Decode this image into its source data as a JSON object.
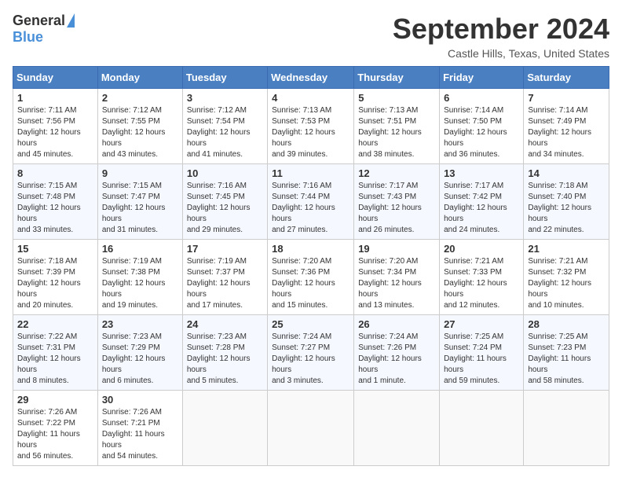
{
  "header": {
    "logo_general": "General",
    "logo_blue": "Blue",
    "title": "September 2024",
    "location": "Castle Hills, Texas, United States"
  },
  "days_of_week": [
    "Sunday",
    "Monday",
    "Tuesday",
    "Wednesday",
    "Thursday",
    "Friday",
    "Saturday"
  ],
  "weeks": [
    [
      {
        "day": "1",
        "sunrise": "7:11 AM",
        "sunset": "7:56 PM",
        "daylight": "12 hours and 45 minutes."
      },
      {
        "day": "2",
        "sunrise": "7:12 AM",
        "sunset": "7:55 PM",
        "daylight": "12 hours and 43 minutes."
      },
      {
        "day": "3",
        "sunrise": "7:12 AM",
        "sunset": "7:54 PM",
        "daylight": "12 hours and 41 minutes."
      },
      {
        "day": "4",
        "sunrise": "7:13 AM",
        "sunset": "7:53 PM",
        "daylight": "12 hours and 39 minutes."
      },
      {
        "day": "5",
        "sunrise": "7:13 AM",
        "sunset": "7:51 PM",
        "daylight": "12 hours and 38 minutes."
      },
      {
        "day": "6",
        "sunrise": "7:14 AM",
        "sunset": "7:50 PM",
        "daylight": "12 hours and 36 minutes."
      },
      {
        "day": "7",
        "sunrise": "7:14 AM",
        "sunset": "7:49 PM",
        "daylight": "12 hours and 34 minutes."
      }
    ],
    [
      {
        "day": "8",
        "sunrise": "7:15 AM",
        "sunset": "7:48 PM",
        "daylight": "12 hours and 33 minutes."
      },
      {
        "day": "9",
        "sunrise": "7:15 AM",
        "sunset": "7:47 PM",
        "daylight": "12 hours and 31 minutes."
      },
      {
        "day": "10",
        "sunrise": "7:16 AM",
        "sunset": "7:45 PM",
        "daylight": "12 hours and 29 minutes."
      },
      {
        "day": "11",
        "sunrise": "7:16 AM",
        "sunset": "7:44 PM",
        "daylight": "12 hours and 27 minutes."
      },
      {
        "day": "12",
        "sunrise": "7:17 AM",
        "sunset": "7:43 PM",
        "daylight": "12 hours and 26 minutes."
      },
      {
        "day": "13",
        "sunrise": "7:17 AM",
        "sunset": "7:42 PM",
        "daylight": "12 hours and 24 minutes."
      },
      {
        "day": "14",
        "sunrise": "7:18 AM",
        "sunset": "7:40 PM",
        "daylight": "12 hours and 22 minutes."
      }
    ],
    [
      {
        "day": "15",
        "sunrise": "7:18 AM",
        "sunset": "7:39 PM",
        "daylight": "12 hours and 20 minutes."
      },
      {
        "day": "16",
        "sunrise": "7:19 AM",
        "sunset": "7:38 PM",
        "daylight": "12 hours and 19 minutes."
      },
      {
        "day": "17",
        "sunrise": "7:19 AM",
        "sunset": "7:37 PM",
        "daylight": "12 hours and 17 minutes."
      },
      {
        "day": "18",
        "sunrise": "7:20 AM",
        "sunset": "7:36 PM",
        "daylight": "12 hours and 15 minutes."
      },
      {
        "day": "19",
        "sunrise": "7:20 AM",
        "sunset": "7:34 PM",
        "daylight": "12 hours and 13 minutes."
      },
      {
        "day": "20",
        "sunrise": "7:21 AM",
        "sunset": "7:33 PM",
        "daylight": "12 hours and 12 minutes."
      },
      {
        "day": "21",
        "sunrise": "7:21 AM",
        "sunset": "7:32 PM",
        "daylight": "12 hours and 10 minutes."
      }
    ],
    [
      {
        "day": "22",
        "sunrise": "7:22 AM",
        "sunset": "7:31 PM",
        "daylight": "12 hours and 8 minutes."
      },
      {
        "day": "23",
        "sunrise": "7:23 AM",
        "sunset": "7:29 PM",
        "daylight": "12 hours and 6 minutes."
      },
      {
        "day": "24",
        "sunrise": "7:23 AM",
        "sunset": "7:28 PM",
        "daylight": "12 hours and 5 minutes."
      },
      {
        "day": "25",
        "sunrise": "7:24 AM",
        "sunset": "7:27 PM",
        "daylight": "12 hours and 3 minutes."
      },
      {
        "day": "26",
        "sunrise": "7:24 AM",
        "sunset": "7:26 PM",
        "daylight": "12 hours and 1 minute."
      },
      {
        "day": "27",
        "sunrise": "7:25 AM",
        "sunset": "7:24 PM",
        "daylight": "11 hours and 59 minutes."
      },
      {
        "day": "28",
        "sunrise": "7:25 AM",
        "sunset": "7:23 PM",
        "daylight": "11 hours and 58 minutes."
      }
    ],
    [
      {
        "day": "29",
        "sunrise": "7:26 AM",
        "sunset": "7:22 PM",
        "daylight": "11 hours and 56 minutes."
      },
      {
        "day": "30",
        "sunrise": "7:26 AM",
        "sunset": "7:21 PM",
        "daylight": "11 hours and 54 minutes."
      },
      null,
      null,
      null,
      null,
      null
    ]
  ]
}
